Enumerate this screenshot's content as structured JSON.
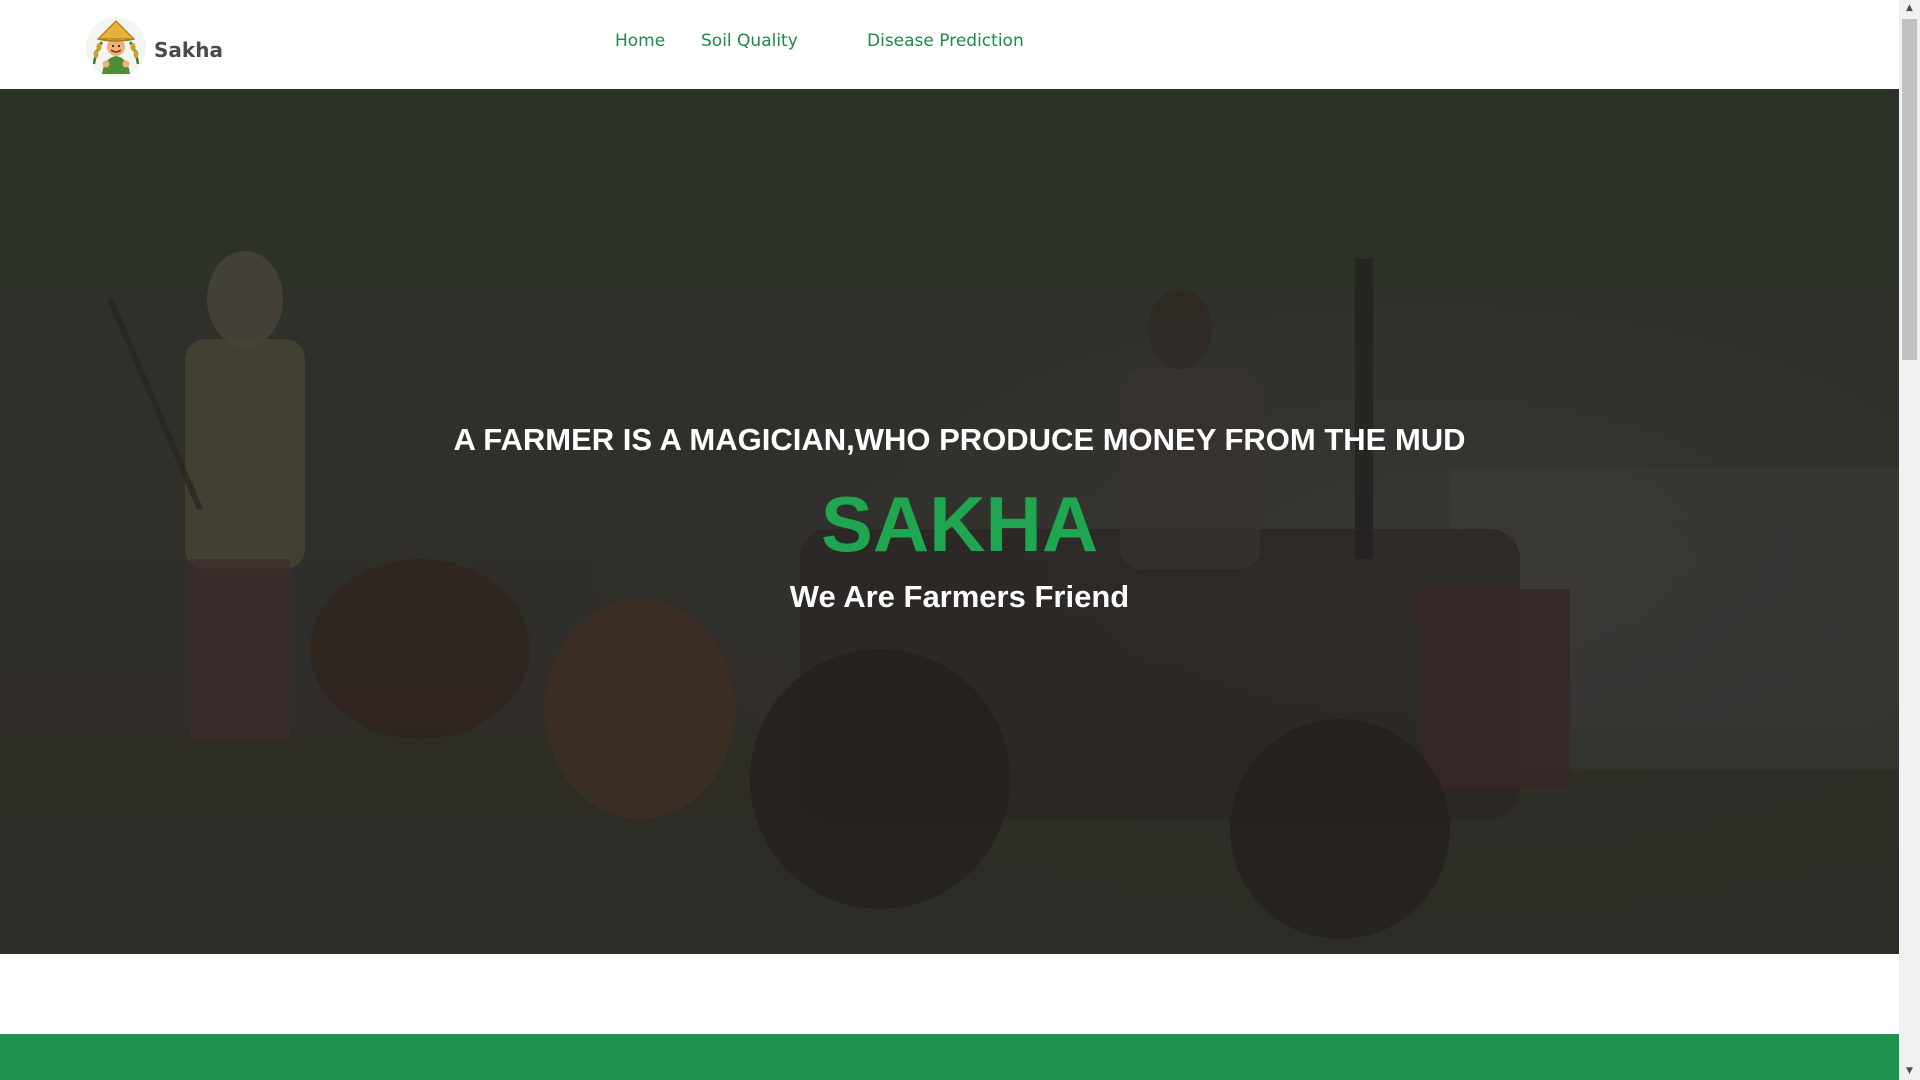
{
  "navbar": {
    "brand_name": "Sakha",
    "logo_icon": "farmer-logo-icon",
    "links": [
      {
        "label": "Home"
      },
      {
        "label": "Soil Quality"
      },
      {
        "label": "Disease Prediction"
      }
    ]
  },
  "hero": {
    "background": "farmers-plowing-field-photo",
    "quote": "A FARMER IS A MAGICIAN,WHO PRODUCE MONEY FROM THE MUD",
    "title": "SAKHA",
    "subtitle": "We Are Farmers Friend"
  },
  "colors": {
    "accent_green": "#20a651",
    "nav_link_green": "#1f8a46",
    "strip_green": "#219150"
  },
  "scrollbar": {
    "up_icon": "arrow-up-icon",
    "down_icon": "arrow-down-icon"
  }
}
